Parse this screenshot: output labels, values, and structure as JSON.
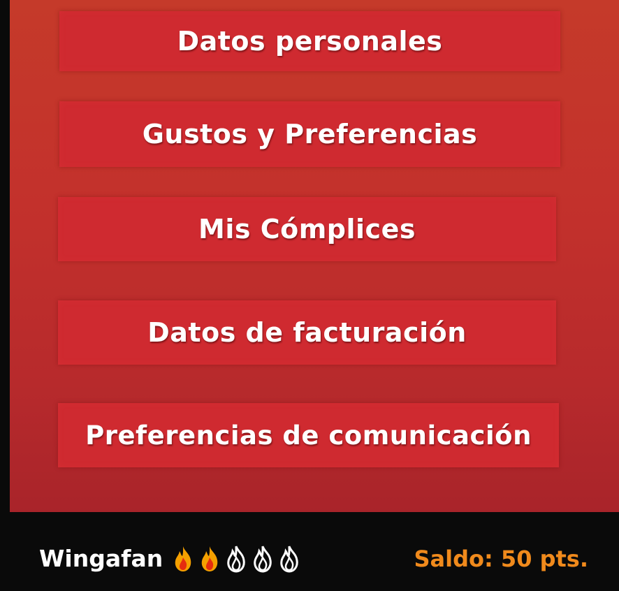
{
  "menu": {
    "items": [
      {
        "label": "Datos personales"
      },
      {
        "label": "Gustos y Preferencias"
      },
      {
        "label": "Mis Cómplices"
      },
      {
        "label": "Datos de facturación"
      },
      {
        "label": "Preferencias de comunicación"
      }
    ]
  },
  "status": {
    "username": "Wingafan",
    "level": {
      "filled": 2,
      "total": 5,
      "icon": "flame-icon"
    },
    "balance": "Saldo: 50 pts."
  },
  "colors": {
    "panel": "#c3312c",
    "button": "#cf2a30",
    "status_bar": "#0a0a0a",
    "balance_text": "#f08a1c",
    "flame_fill": "#f5a000",
    "flame_core": "#e52d0f",
    "flame_empty_stroke": "#ffffff"
  }
}
